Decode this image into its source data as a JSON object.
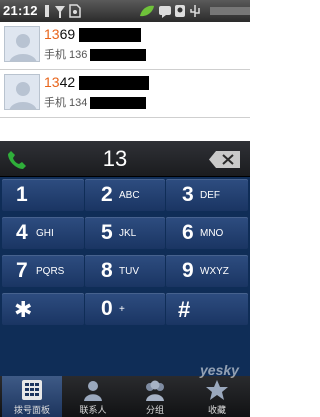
{
  "status_bar": {
    "time": "21:12",
    "icons": [
      "sim-icon",
      "signal-icon",
      "sd-card-icon",
      "battery-leaf-icon",
      "message-icon",
      "usb-icon",
      "data-icon"
    ]
  },
  "contacts": [
    {
      "name_highlight": "13",
      "name_rest": "69",
      "number_prefix": "手机 136"
    },
    {
      "name_highlight": "13",
      "name_rest": "42",
      "number_prefix": "手机 134"
    }
  ],
  "dialer": {
    "input_value": "13",
    "keys": [
      {
        "digit": "1",
        "letters": ""
      },
      {
        "digit": "2",
        "letters": "ABC"
      },
      {
        "digit": "3",
        "letters": "DEF"
      },
      {
        "digit": "4",
        "letters": "GHI"
      },
      {
        "digit": "5",
        "letters": "JKL"
      },
      {
        "digit": "6",
        "letters": "MNO"
      },
      {
        "digit": "7",
        "letters": "PQRS"
      },
      {
        "digit": "8",
        "letters": "TUV"
      },
      {
        "digit": "9",
        "letters": "WXYZ"
      },
      {
        "digit": "✱",
        "letters": ""
      },
      {
        "digit": "0",
        "letters": "+"
      },
      {
        "digit": "#",
        "letters": ""
      }
    ]
  },
  "tabs": [
    {
      "label": "拨号面板",
      "icon": "dialpad-icon",
      "active": true
    },
    {
      "label": "联系人",
      "icon": "contact-person-icon",
      "active": false
    },
    {
      "label": "分组",
      "icon": "group-icon",
      "active": false
    },
    {
      "label": "收藏",
      "icon": "favorites-icon",
      "active": false
    }
  ],
  "watermark": "yesky",
  "colors": {
    "highlight": "#e8641a",
    "call_green": "#2fae3a",
    "dialer_bg": "#0f2d57"
  }
}
